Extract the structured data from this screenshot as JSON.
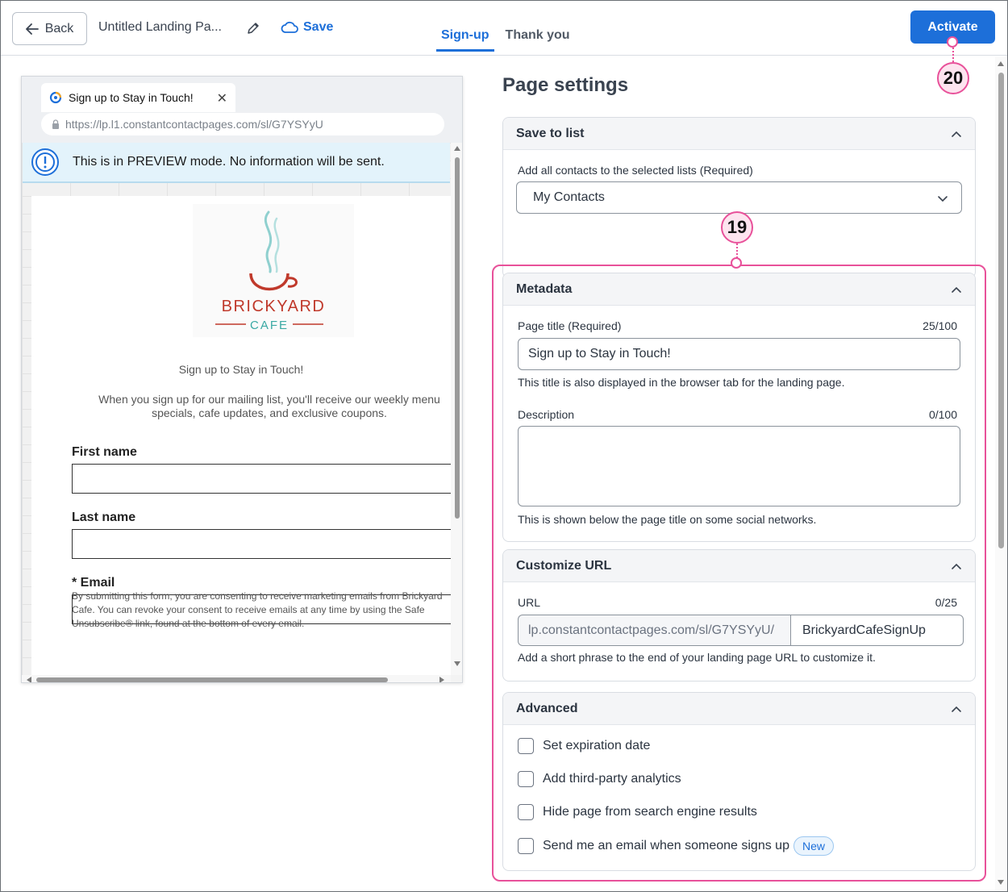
{
  "topbar": {
    "back_label": "Back",
    "page_name": "Untitled Landing Pa...",
    "save_label": "Save",
    "tabs": [
      {
        "label": "Sign-up",
        "active": true
      },
      {
        "label": "Thank you",
        "active": false
      }
    ],
    "activate_label": "Activate",
    "accent_color": "#1d6fd9"
  },
  "preview": {
    "browser_tab_title": "Sign up to Stay in Touch!",
    "address": "https://lp.l1.constantcontactpages.com/sl/G7YSYyU",
    "banner": "This is in PREVIEW mode. No information will be sent.",
    "logo_line1": "BRICKYARD",
    "logo_line2": "CAFE",
    "form_title": "Sign up to Stay in Touch!",
    "form_desc": "When you sign up for our mailing list, you'll receive our weekly menu specials, cafe updates, and exclusive coupons.",
    "fields": [
      {
        "label": "First name"
      },
      {
        "label": "Last name"
      },
      {
        "label": "* Email"
      }
    ],
    "legal": "By submitting this form, you are consenting to receive marketing emails from Brickyard Cafe. You can revoke your consent to receive emails at any time by using the Safe Unsubscribe® link, found at the bottom of every email."
  },
  "settings": {
    "title": "Page settings",
    "save_to_list": {
      "header": "Save to list",
      "label": "Add all contacts to the selected lists",
      "required": "(Required)",
      "selected": "My Contacts"
    },
    "metadata": {
      "header": "Metadata",
      "page_title_label": "Page title",
      "required": "(Required)",
      "page_title_count": "25/100",
      "page_title_value": "Sign up to Stay in Touch!",
      "page_title_help": "This title is also displayed in the browser tab for the landing page.",
      "description_label": "Description",
      "description_count": "0/100",
      "description_help": "This is shown below the page title on some social networks."
    },
    "customize_url": {
      "header": "Customize URL",
      "label": "URL",
      "count": "0/25",
      "prefix": "lp.constantcontactpages.com/sl/G7YSYyU/",
      "value": "BrickyardCafeSignUp",
      "help": "Add a short phrase to the end of your landing page URL to customize it."
    },
    "advanced": {
      "header": "Advanced",
      "options": [
        {
          "label": "Set expiration date",
          "checked": false
        },
        {
          "label": "Add third-party analytics",
          "checked": false
        },
        {
          "label": "Hide page from search engine results",
          "checked": false
        },
        {
          "label": "Send me an email when someone signs up",
          "checked": false
        }
      ],
      "new_badge": "New"
    }
  },
  "annotations": {
    "callout_19": "19",
    "callout_20": "20",
    "highlight_color": "#e8519a"
  }
}
